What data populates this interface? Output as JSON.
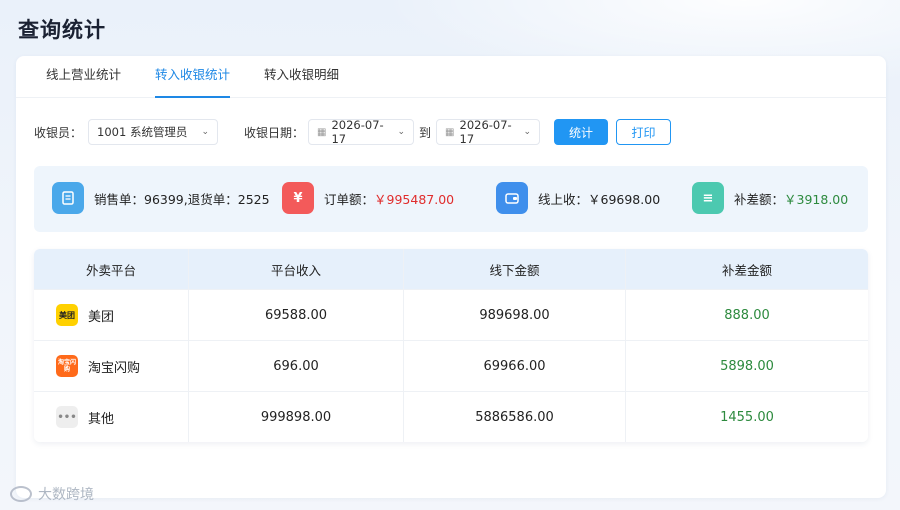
{
  "page": {
    "title": "查询统计"
  },
  "tabs": [
    {
      "label": "线上营业统计",
      "active": false
    },
    {
      "label": "转入收银统计",
      "active": true
    },
    {
      "label": "转入收银明细",
      "active": false
    }
  ],
  "filters": {
    "cashier_label": "收银员：",
    "cashier_value": "1001 系统管理员",
    "date_label": "收银日期：",
    "date_from": "2026-07-17",
    "date_sep": "到",
    "date_to": "2026-07-17",
    "stat_button": "统计",
    "print_button": "打印"
  },
  "summary": {
    "sales_text": "销售单：96399,退货单：2525",
    "order_label": "订单额：",
    "order_value": "￥995487.00",
    "online_text": "线上收：￥69698.00",
    "subsidy_label": "补差额：",
    "subsidy_value": "￥3918.00",
    "icons": [
      "document-icon",
      "yen-tag-icon",
      "wallet-icon",
      "ticket-icon"
    ],
    "icon_glyphs": {
      "yen": "¥",
      "ticket": "≡"
    },
    "colors": {
      "blue": "#4aa8ea",
      "red": "#f35a5a",
      "wallet": "#3f8fec",
      "teal": "#4cc9b0"
    }
  },
  "table": {
    "headers": [
      "外卖平台",
      "平台收入",
      "线下金额",
      "补差金额"
    ],
    "rows": [
      {
        "platform": "美团",
        "icon_text": "美团",
        "icon": "meituan-icon",
        "platform_income": "69588.00",
        "offline_amount": "989698.00",
        "subsidy": "888.00"
      },
      {
        "platform": "淘宝闪购",
        "icon_text": "淘宝闪购",
        "icon": "taobao-shangou-icon",
        "platform_income": "696.00",
        "offline_amount": "69966.00",
        "subsidy": "5898.00"
      },
      {
        "platform": "其他",
        "icon_text": "•••",
        "icon": "more-dots-icon",
        "platform_income": "999898.00",
        "offline_amount": "5886586.00",
        "subsidy": "1455.00"
      }
    ]
  },
  "watermark": {
    "text": "大数跨境"
  }
}
